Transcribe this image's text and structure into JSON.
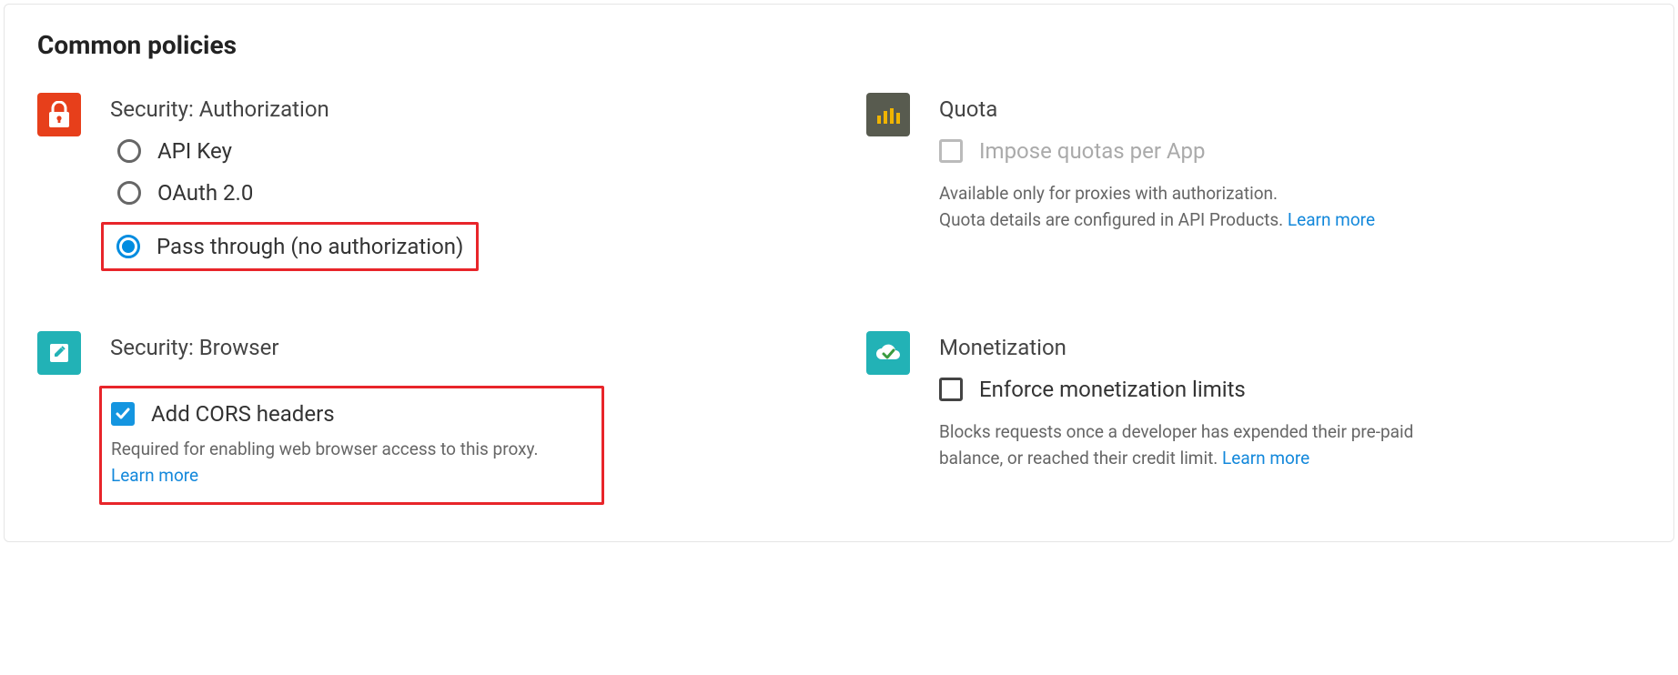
{
  "section_title": "Common policies",
  "security_auth": {
    "title": "Security: Authorization",
    "options": {
      "api_key": "API Key",
      "oauth": "OAuth 2.0",
      "passthrough": "Pass through (no authorization)"
    },
    "selected": "passthrough"
  },
  "quota": {
    "title": "Quota",
    "checkbox_label": "Impose quotas per App",
    "help_line1": "Available only for proxies with authorization.",
    "help_line2": "Quota details are configured in API Products. ",
    "learn_more": "Learn more"
  },
  "security_browser": {
    "title": "Security: Browser",
    "checkbox_label": "Add CORS headers",
    "checked": true,
    "help": "Required for enabling web browser access to this proxy.",
    "learn_more": "Learn more"
  },
  "monetization": {
    "title": "Monetization",
    "checkbox_label": "Enforce monetization limits",
    "help": "Blocks requests once a developer has expended their pre-paid balance, or reached their credit limit. ",
    "learn_more": "Learn more"
  }
}
